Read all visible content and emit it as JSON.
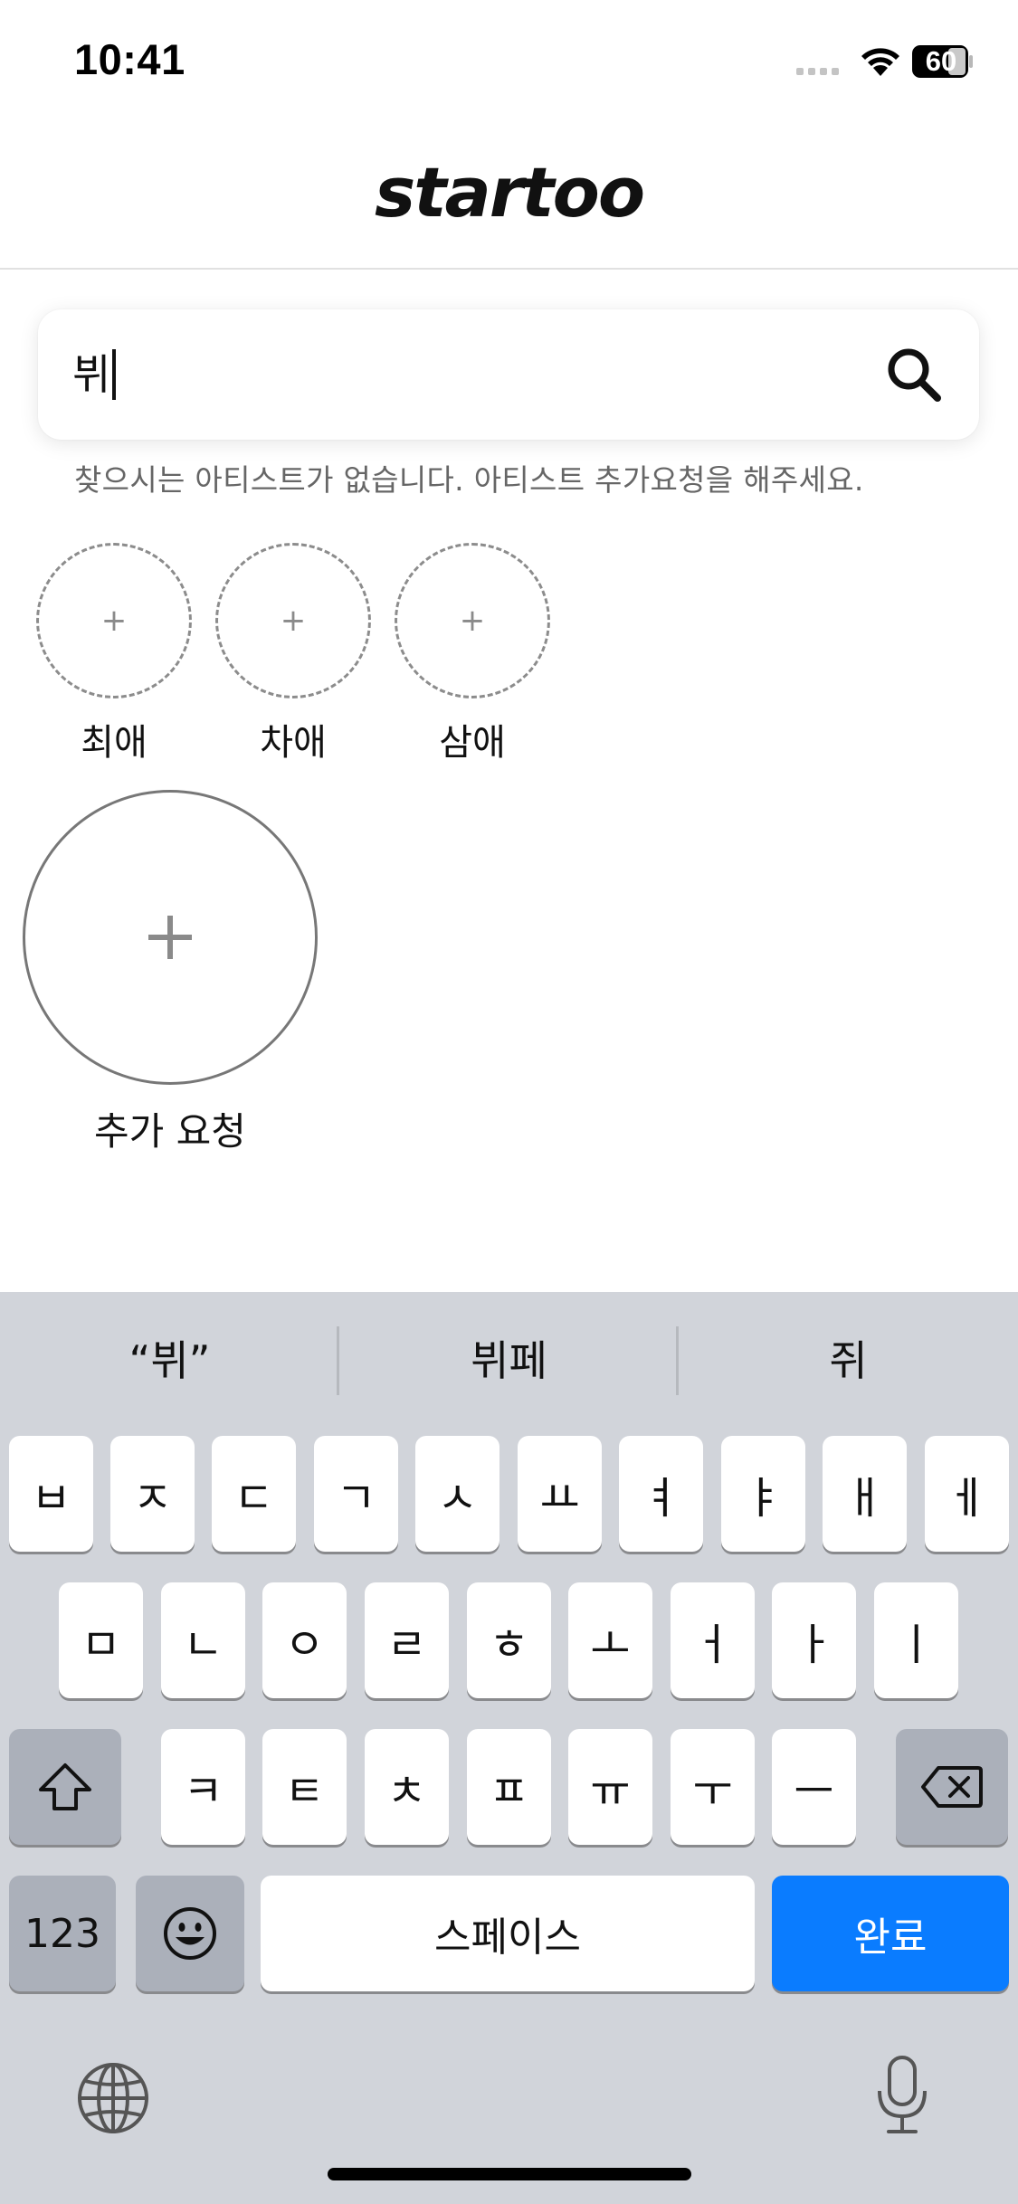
{
  "status_bar": {
    "time": "10:41",
    "battery": "60"
  },
  "header": {
    "logo": "startoo"
  },
  "search": {
    "value": "뷔"
  },
  "empty_message": "찾으시는 아티스트가 없습니다. 아티스트 추가요청을 해주세요.",
  "slots": [
    {
      "label": "최애",
      "plus": "+"
    },
    {
      "label": "차애",
      "plus": "+"
    },
    {
      "label": "삼애",
      "plus": "+"
    }
  ],
  "request": {
    "label": "추가 요청"
  },
  "keyboard": {
    "suggestions": [
      "“뷔”",
      "뷔페",
      "쥐"
    ],
    "row1": [
      "ㅂ",
      "ㅈ",
      "ㄷ",
      "ㄱ",
      "ㅅ",
      "ㅛ",
      "ㅕ",
      "ㅑ",
      "ㅐ",
      "ㅔ"
    ],
    "row2": [
      "ㅁ",
      "ㄴ",
      "ㅇ",
      "ㄹ",
      "ㅎ",
      "ㅗ",
      "ㅓ",
      "ㅏ",
      "ㅣ"
    ],
    "row3": [
      "ㅋ",
      "ㅌ",
      "ㅊ",
      "ㅍ",
      "ㅠ",
      "ㅜ",
      "ㅡ"
    ],
    "numbers_label": "123",
    "space_label": "스페이스",
    "done_label": "완료"
  }
}
